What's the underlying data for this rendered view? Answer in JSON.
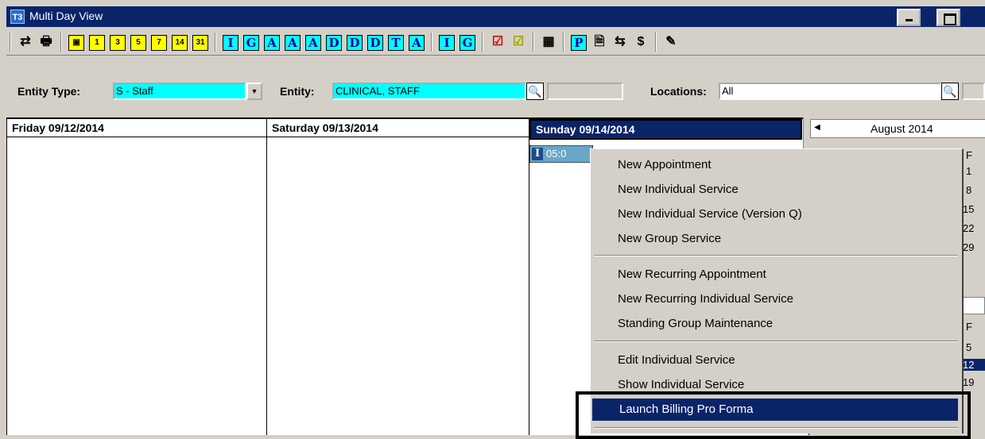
{
  "window": {
    "icon_text": "T3",
    "title": "Multi Day View"
  },
  "toolbar": {
    "buttons": [
      {
        "name": "refresh-icon",
        "text": "⇄",
        "style": "plain"
      },
      {
        "name": "print-icon",
        "text": "🖶",
        "style": "plain"
      },
      {
        "name": "calendar-today-button",
        "text": "▣",
        "style": "yellow"
      },
      {
        "name": "day1-button",
        "text": "1",
        "style": "yellow"
      },
      {
        "name": "day3-button",
        "text": "3",
        "style": "yellow"
      },
      {
        "name": "day5-button",
        "text": "5",
        "style": "yellow"
      },
      {
        "name": "day7-button",
        "text": "7",
        "style": "yellow"
      },
      {
        "name": "day14-button",
        "text": "14",
        "style": "yellow"
      },
      {
        "name": "day31-button",
        "text": "31",
        "style": "yellow"
      },
      {
        "name": "individual-button",
        "text": "I",
        "style": "cyan"
      },
      {
        "name": "group-button",
        "text": "G",
        "style": "cyan"
      },
      {
        "name": "appointment-button",
        "text": "A",
        "style": "cyan"
      },
      {
        "name": "appointment-yellow-button",
        "text": "A",
        "style": "cyan"
      },
      {
        "name": "appointment-green-button",
        "text": "A",
        "style": "cyan"
      },
      {
        "name": "d-button",
        "text": "D",
        "style": "cyan"
      },
      {
        "name": "d-yellow-button",
        "text": "D",
        "style": "cyan"
      },
      {
        "name": "d-green-button",
        "text": "D",
        "style": "cyan"
      },
      {
        "name": "t-button",
        "text": "T",
        "style": "cyan"
      },
      {
        "name": "a2-button",
        "text": "A",
        "style": "cyan"
      },
      {
        "name": "i2-button",
        "text": "I",
        "style": "cyan"
      },
      {
        "name": "g2-button",
        "text": "G",
        "style": "cyan"
      },
      {
        "name": "check-red-icon",
        "text": "☑",
        "style": "plain"
      },
      {
        "name": "check-yellow-icon",
        "text": "☑",
        "style": "plain"
      },
      {
        "name": "grid-icon",
        "text": "▦",
        "style": "plain"
      },
      {
        "name": "p-button",
        "text": "P",
        "style": "cyan"
      },
      {
        "name": "report-icon",
        "text": "🗎",
        "style": "plain"
      },
      {
        "name": "transfer-icon",
        "text": "⇆",
        "style": "plain"
      },
      {
        "name": "billing-icon",
        "text": "$",
        "style": "plain"
      },
      {
        "name": "notes-icon",
        "text": "✎",
        "style": "plain"
      }
    ]
  },
  "filters": {
    "entity_type_label": "Entity Type:",
    "entity_type_value": "S - Staff",
    "entity_label": "Entity:",
    "entity_value": "CLINICAL, STAFF",
    "locations_label": "Locations:",
    "locations_value": "All"
  },
  "days": [
    {
      "label": "Friday 09/12/2014"
    },
    {
      "label": "Saturday 09/13/2014"
    },
    {
      "label": "Sunday 09/14/2014"
    }
  ],
  "appointment": {
    "icon": "I",
    "time": "05:0"
  },
  "calendar": {
    "month": "August 2014",
    "day_header": "F",
    "dates_top": [
      "1",
      "8",
      "15",
      "22",
      "29"
    ],
    "day_header2": "F",
    "dates_bottom": [
      "5",
      "12",
      "19"
    ]
  },
  "context_menu": {
    "items": [
      {
        "label": "New Appointment"
      },
      {
        "label": "New Individual Service"
      },
      {
        "label": "New Individual Service (Version Q)"
      },
      {
        "label": "New Group Service"
      },
      {
        "label": "New Recurring Appointment"
      },
      {
        "label": "New Recurring Individual Service"
      },
      {
        "label": "Standing Group Maintenance"
      },
      {
        "label": "Edit Individual Service"
      },
      {
        "label": "Show Individual Service"
      },
      {
        "label": "Launch Billing Pro Forma"
      }
    ]
  }
}
